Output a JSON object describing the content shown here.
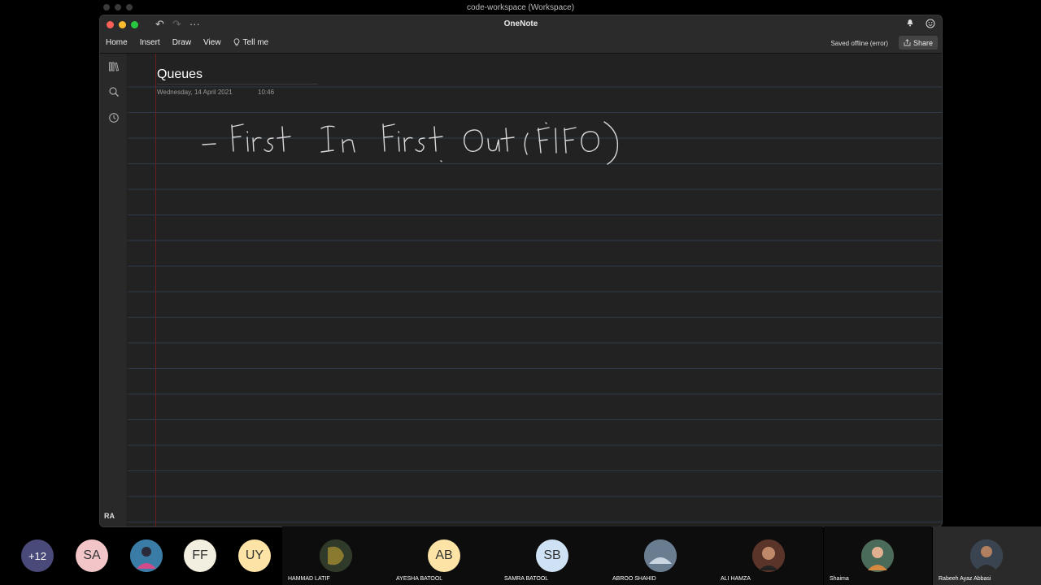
{
  "outer_window": {
    "title": "code-workspace (Workspace)"
  },
  "app": {
    "title": "OneNote",
    "quick_access": {
      "undo": "↶",
      "redo": "↷",
      "more": "···"
    },
    "topbar_icons": {
      "bell": "bell-icon",
      "smiley": "smiley-icon"
    }
  },
  "ribbon": {
    "tabs": [
      "Home",
      "Insert",
      "Draw",
      "View"
    ],
    "tell_me": "Tell me",
    "status": "Saved offline (error)",
    "share": "Share"
  },
  "sidebar": {
    "user_initials": "RA"
  },
  "page": {
    "title": "Queues",
    "date": "Wednesday, 14 April 2021",
    "time": "10:46",
    "handwritten_note": "- First In First Out (FIFO)"
  },
  "participants": {
    "overflow": "+12",
    "circles": [
      {
        "initials": "SA",
        "color": "#f2c6c9"
      },
      {
        "initials": "",
        "color": "#3a7ca5"
      },
      {
        "initials": "FF",
        "color": "#f3efe0"
      },
      {
        "initials": "UY",
        "color": "#fde4a6"
      }
    ],
    "tiles": [
      {
        "name": "HAMMAD LATIF",
        "initials": "",
        "color": "#5a5a30"
      },
      {
        "name": "AYESHA BATOOL",
        "initials": "AB",
        "color": "#fde4a6"
      },
      {
        "name": "SAMRA BATOOL",
        "initials": "SB",
        "color": "#cfe2f5"
      },
      {
        "name": "ABROO SHAHID",
        "initials": "",
        "color": "#8fa3b8"
      },
      {
        "name": "ALI HAMZA",
        "initials": "",
        "color": "#7a4a3a"
      },
      {
        "name": "Shaima",
        "initials": "",
        "color": "#a56a3a"
      },
      {
        "name": "Rabeeh Ayaz  Abbasi",
        "initials": "",
        "color": "#556070"
      }
    ]
  }
}
